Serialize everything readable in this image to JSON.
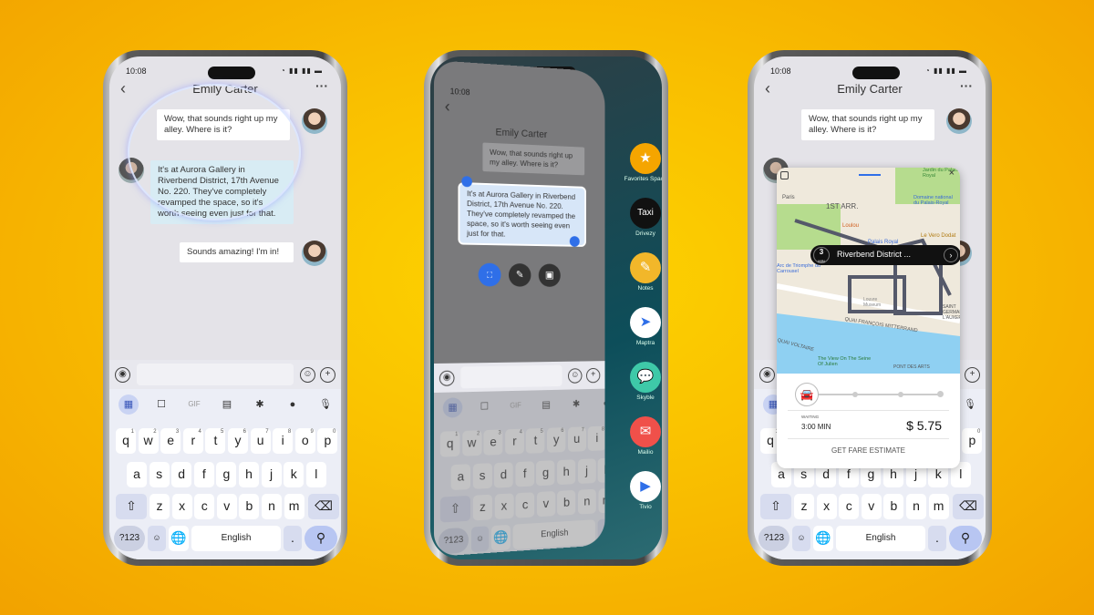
{
  "colors": {
    "background": "#f9bf00",
    "selection": "#2f6fe8",
    "bubble_incoming": "#d8ecf4"
  },
  "status": {
    "time": "10:08",
    "signal": "wifi 4G 4G battery"
  },
  "chat": {
    "contact": "Emily Carter",
    "messages": [
      {
        "from": "me",
        "text": "Wow, that sounds right up my alley. Where is it?"
      },
      {
        "from": "other",
        "text": "It's at Aurora Gallery in Riverbend District, 17th Avenue No. 220. They've completely revamped the space, so it's worth seeing even just for that."
      },
      {
        "from": "me",
        "text": "Sounds amazing! I'm in!"
      }
    ]
  },
  "keyboard": {
    "toolbar": [
      "apps-icon",
      "sticker-icon",
      "GIF",
      "clipboard-icon",
      "gear-icon",
      "palette-icon",
      "mic-icon"
    ],
    "gif": "GIF",
    "row1": [
      "q",
      "w",
      "e",
      "r",
      "t",
      "y",
      "u",
      "i",
      "o",
      "p"
    ],
    "row1_hints": [
      "1",
      "2",
      "3",
      "4",
      "5",
      "6",
      "7",
      "8",
      "9",
      "0"
    ],
    "row2": [
      "a",
      "s",
      "d",
      "f",
      "g",
      "h",
      "j",
      "k",
      "l"
    ],
    "row3": [
      "z",
      "x",
      "c",
      "v",
      "b",
      "n",
      "m"
    ],
    "symbols": "?123",
    "space": "English",
    "period": "."
  },
  "dock": {
    "apps": [
      {
        "label": "Favorites Space",
        "color": "#f5a500"
      },
      {
        "label": "Drivezy",
        "color": "#111111",
        "glyph": "Taxi"
      },
      {
        "label": "Notes",
        "color": "#f2b72a"
      },
      {
        "label": "Maptra",
        "color": "#ffffff"
      },
      {
        "label": "Skyble",
        "color": "#3ec9a8"
      },
      {
        "label": "Mailio",
        "color": "#f0504a"
      },
      {
        "label": "Tivio",
        "color": "#ffffff"
      }
    ]
  },
  "map": {
    "labels": [
      "1ST ARR.",
      "Paris",
      "Loulou",
      "Palais Royal",
      "Le Vero Dodat",
      "Jardin du Palais Royal",
      "Domaine national du Palais-Royal",
      "Arc de Triomphe du Carrousel",
      "Louvre Museum",
      "QUAI FRANÇOIS MITTERRAND",
      "QUAI VOLTAIRE",
      "The View On The Seine Of Julien",
      "SAINT GERMAIN L'AUXERROIS",
      "PONT DES ARTS"
    ],
    "eta_value": "3",
    "eta_unit": "MIN",
    "destination": "Riverbend District ...",
    "waiting_label": "WAITING",
    "waiting_time": "3:00 MIN",
    "price": "$ 5.75",
    "fare_button": "GET FARE ESTIMATE"
  }
}
